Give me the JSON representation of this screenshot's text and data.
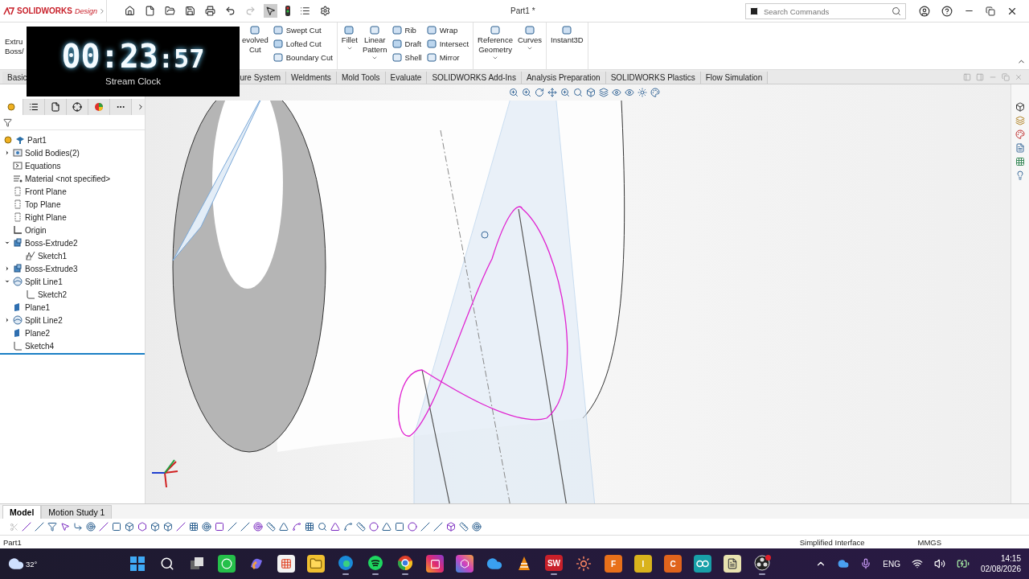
{
  "app": {
    "brand": "SOLIDWORKS",
    "brand_suffix": "Design",
    "title": "Part1 *"
  },
  "search": {
    "placeholder": "Search Commands"
  },
  "ribbon": {
    "left_item": {
      "lines": [
        "Extru",
        "Boss/"
      ]
    },
    "groups": [
      {
        "items": [
          {
            "kind": "big",
            "lines": [
              "evolved",
              "Cut"
            ]
          },
          {
            "kind": "stack",
            "labels": [
              "Swept Cut",
              "Lofted Cut",
              "Boundary Cut"
            ]
          }
        ]
      },
      {
        "items": [
          {
            "kind": "big",
            "lines": [
              "Fillet"
            ],
            "caret": true
          },
          {
            "kind": "big",
            "lines": [
              "Linear",
              "Pattern"
            ],
            "caret": true
          },
          {
            "kind": "stack",
            "labels": [
              "Rib",
              "Draft",
              "Shell"
            ]
          },
          {
            "kind": "stack",
            "labels": [
              "Wrap",
              "Intersect",
              "Mirror"
            ]
          }
        ]
      },
      {
        "items": [
          {
            "kind": "big",
            "lines": [
              "Reference",
              "Geometry"
            ],
            "caret": true
          },
          {
            "kind": "big",
            "lines": [
              "Curves"
            ],
            "caret": true
          }
        ]
      },
      {
        "items": [
          {
            "kind": "big",
            "lines": [
              "Instant3D"
            ]
          }
        ]
      }
    ]
  },
  "command_tabs": {
    "left": [
      {
        "label": "Basic",
        "selected": false
      }
    ],
    "right": [
      {
        "label": "ure System",
        "selected": false
      },
      {
        "label": "Weldments",
        "selected": false
      },
      {
        "label": "Mold Tools",
        "selected": false
      },
      {
        "label": "Evaluate",
        "selected": false
      },
      {
        "label": "SOLIDWORKS Add-Ins",
        "selected": false
      },
      {
        "label": "Analysis Preparation",
        "selected": false
      },
      {
        "label": "SOLIDWORKS Plastics",
        "selected": false
      },
      {
        "label": "Flow Simulation",
        "selected": false
      }
    ]
  },
  "clock": {
    "main": "00:23",
    "seconds": ":57",
    "label": "Stream Clock"
  },
  "feature_tree": {
    "root": {
      "label": "Part1",
      "kind": "part"
    },
    "items": [
      {
        "label": "Solid Bodies(2)",
        "kind": "bodies",
        "expanded": false
      },
      {
        "label": "Equations",
        "kind": "equations"
      },
      {
        "label": "Material <not specified>",
        "kind": "material"
      },
      {
        "label": "Front Plane",
        "kind": "plane"
      },
      {
        "label": "Top Plane",
        "kind": "plane"
      },
      {
        "label": "Right Plane",
        "kind": "plane"
      },
      {
        "label": "Origin",
        "kind": "origin"
      },
      {
        "label": "Boss-Extrude2",
        "kind": "extrude",
        "expanded": true,
        "children": [
          {
            "label": "Sketch1",
            "kind": "sketch3d"
          }
        ]
      },
      {
        "label": "Boss-Extrude3",
        "kind": "extrude",
        "expanded": false
      },
      {
        "label": "Split Line1",
        "kind": "split",
        "expanded": true,
        "children": [
          {
            "label": "Sketch2",
            "kind": "sketch"
          }
        ]
      },
      {
        "label": "Plane1",
        "kind": "refplane"
      },
      {
        "label": "Split Line2",
        "kind": "split",
        "expanded": false
      },
      {
        "label": "Plane2",
        "kind": "refplane"
      },
      {
        "label": "Sketch4",
        "kind": "sketch"
      }
    ]
  },
  "bottom_tabs": [
    {
      "label": "Model",
      "selected": true
    },
    {
      "label": "Motion Study 1",
      "selected": false
    }
  ],
  "status_bar": {
    "document": "Part1",
    "mode": "Simplified Interface",
    "units": "MMGS"
  },
  "taskbar": {
    "weather": "32°",
    "apps": [
      {
        "kind": "start"
      },
      {
        "kind": "search"
      },
      {
        "kind": "taskview"
      },
      {
        "kind": "whatsapp"
      },
      {
        "kind": "copilot"
      },
      {
        "kind": "store"
      },
      {
        "kind": "files"
      },
      {
        "kind": "edge",
        "running": true
      },
      {
        "kind": "spotify",
        "running": true
      },
      {
        "kind": "chrome",
        "running": true
      },
      {
        "kind": "instagram"
      },
      {
        "kind": "copilot365"
      },
      {
        "kind": "onedrive"
      },
      {
        "kind": "vlc"
      },
      {
        "kind": "letter",
        "letter": "SW",
        "color": "#c8202a",
        "running": true
      },
      {
        "kind": "burst"
      },
      {
        "kind": "letter",
        "letter": "F",
        "color": "#e8701a"
      },
      {
        "kind": "letter",
        "letter": "I",
        "color": "#d9b31c"
      },
      {
        "kind": "letter",
        "letter": "C",
        "color": "#e0641c"
      },
      {
        "kind": "arduino"
      },
      {
        "kind": "notes"
      },
      {
        "kind": "obs",
        "running": true
      }
    ],
    "language": "ENG",
    "time": "14:15",
    "date": "02/08/2026"
  }
}
